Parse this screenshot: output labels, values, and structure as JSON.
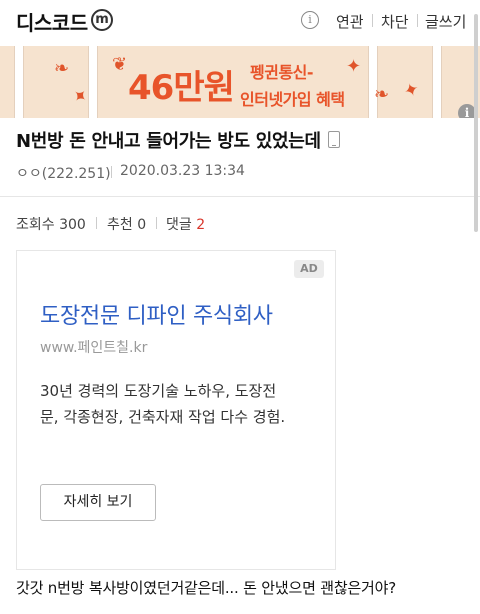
{
  "header": {
    "gallery_name": "디스코드",
    "minor_badge": "m",
    "info_icon": "info-icon",
    "links": [
      "연관",
      "차단",
      "글쓰기"
    ]
  },
  "banner": {
    "amount": "46만원",
    "line1": "펭귄통신-",
    "line2": "인터넷가입 혜택",
    "info_glyph": "i",
    "colors": {
      "background": "#f6e3cf",
      "accent": "#e8542a"
    }
  },
  "post": {
    "title": "N번방 돈 안내고 들어가는 방도 있었는데",
    "device_icon": "mobile-icon",
    "author": "ㅇㅇ(222.251)",
    "date": "2020.03.23 13:34",
    "stats": {
      "views_label": "조회수",
      "views": "300",
      "recommend_label": "추천",
      "recommend": "0",
      "comments_label": "댓글",
      "comments": "2"
    },
    "body": "갓갓 n번방 복사방이였던거같은데... 돈 안냈으면 괜찮은거야?"
  },
  "ad": {
    "badge": "AD",
    "title": "도장전문 디파인 주식회사",
    "url": "www.페인트칠.kr",
    "description_line1": "30년 경력의 도장기술 노하우, 도장전",
    "description_line2": "문, 각종현장, 건축자재 작업 다수 경험.",
    "button": "자세히 보기",
    "colors": {
      "title": "#2f5fc4"
    }
  }
}
